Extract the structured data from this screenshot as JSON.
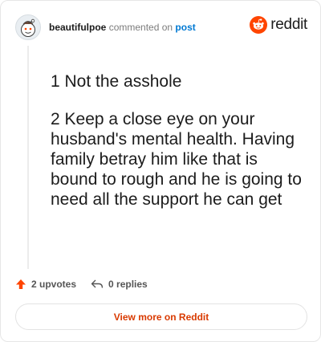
{
  "header": {
    "username": "beautifulpoe",
    "action_text": "commented on",
    "post_link": "post",
    "logo_text": "reddit"
  },
  "comment": {
    "paragraphs": [
      "1 Not the asshole",
      "2 Keep a close eye on your husband's mental health. Having family betray him like that is bound to rough and he is going to need all the support he can get"
    ]
  },
  "footer": {
    "upvotes": "2 upvotes",
    "replies": "0 replies"
  },
  "cta": {
    "label": "View more on Reddit"
  },
  "colors": {
    "brand": "#ff4500",
    "link": "#0079d3",
    "cta_text": "#d93a00"
  },
  "icons": {
    "avatar": "snoo-avatar-icon",
    "logo": "reddit-logo-icon",
    "upvote": "upvote-arrow-icon",
    "reply": "reply-arrow-icon"
  }
}
